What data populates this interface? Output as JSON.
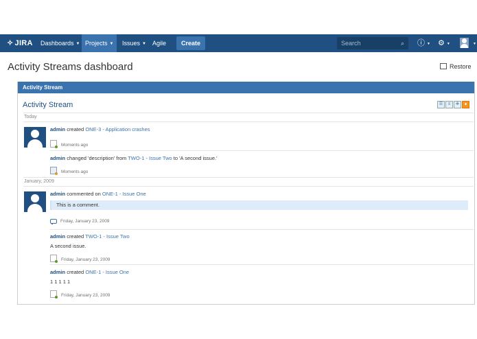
{
  "nav": {
    "logo": "JIRA",
    "dashboards": "Dashboards",
    "projects": "Projects",
    "issues": "Issues",
    "agile": "Agile",
    "create": "Create",
    "search_placeholder": "Search"
  },
  "page": {
    "title": "Activity Streams dashboard",
    "restore": "Restore"
  },
  "gadget": {
    "header": "Activity Stream",
    "title": "Activity Stream"
  },
  "groups": [
    {
      "label": "Today"
    },
    {
      "label": "January, 2009"
    }
  ],
  "entries": [
    {
      "user": "admin",
      "action": "created",
      "link": "ONE-3 - Application crashes",
      "time": "Moments ago"
    },
    {
      "user": "admin",
      "action_pre": "changed 'description' from",
      "link": "TWO-1 - Issue Two",
      "action_post": "to 'A second issue.'",
      "time": "Moments ago"
    },
    {
      "user": "admin",
      "action": "commented on",
      "link": "ONE-1 - Issue One",
      "comment": "This is a comment.",
      "time": "Friday, January 23, 2009"
    },
    {
      "user": "admin",
      "action": "created",
      "link": "TWO-1 - Issue Two",
      "body": "A second issue.",
      "time": "Friday, January 23, 2009"
    },
    {
      "user": "admin",
      "action": "created",
      "link": "ONE-1 - Issue One",
      "body": "1 1 1 1 1",
      "time": "Friday, January 23, 2009"
    }
  ]
}
